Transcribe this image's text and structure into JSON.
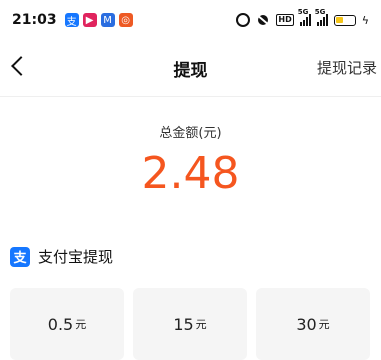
{
  "status": {
    "time": "21:03",
    "notifications": [
      {
        "name": "alipay-notif-icon",
        "glyph": "支",
        "color": "#1677ff"
      },
      {
        "name": "video-notif-icon",
        "glyph": "▶",
        "color": "#e0245e"
      },
      {
        "name": "mail-notif-icon",
        "glyph": "M",
        "color": "#2a6de0"
      },
      {
        "name": "camera-notif-icon",
        "glyph": "◎",
        "color": "#ee5a24"
      }
    ],
    "hd": "HD",
    "network1": "5G",
    "network2": "5G",
    "bolt": "ϟ"
  },
  "nav": {
    "title": "提现",
    "record": "提现记录"
  },
  "balance": {
    "label": "总金额(元)",
    "amount": "2.48"
  },
  "section": {
    "icon_glyph": "支",
    "title": "支付宝提现"
  },
  "options": [
    {
      "amount": "0.5",
      "unit": "元"
    },
    {
      "amount": "15",
      "unit": "元"
    },
    {
      "amount": "30",
      "unit": "元"
    }
  ],
  "colors": {
    "accent": "#f5561f",
    "alipay": "#1677ff"
  }
}
